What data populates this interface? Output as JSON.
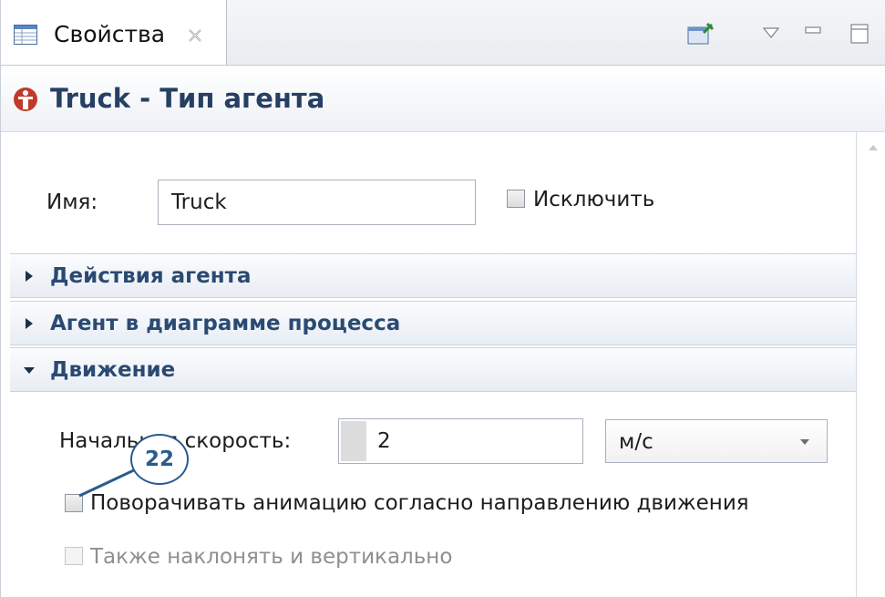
{
  "tab": {
    "label": "Свойства"
  },
  "header": {
    "title": "Truck - Тип агента"
  },
  "name_row": {
    "label": "Имя:",
    "value": "Truck",
    "exclude_label": "Исключить"
  },
  "sections": [
    {
      "label": "Действия агента",
      "expanded": false
    },
    {
      "label": "Агент в диаграмме процесса",
      "expanded": false
    },
    {
      "label": "Движение",
      "expanded": true
    }
  ],
  "movement": {
    "speed_label": "Начальная скорость:",
    "speed_value": "2",
    "speed_unit": "м/с",
    "rotate_label": "Поворачивать анимацию согласно направлению движения",
    "tilt_label": "Также наклонять и вертикально"
  },
  "callout": {
    "number": "22"
  },
  "colors": {
    "accent": "#2b4a72",
    "title": "#263f63",
    "callout": "#2a5b8c",
    "warning_icon": "#c0392b"
  }
}
